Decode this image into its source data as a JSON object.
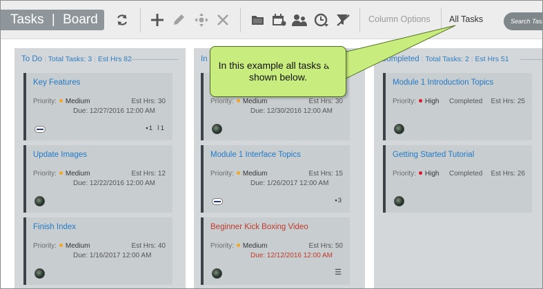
{
  "app": {
    "title": "Tasks",
    "view": "Board",
    "divider": "|"
  },
  "toolbar": {
    "icons": [
      "refresh-icon",
      "add-icon",
      "edit-icon",
      "move-icon",
      "delete-icon",
      "folder-icon",
      "calendar-icon",
      "users-icon",
      "clock-icon",
      "filter-off-icon"
    ],
    "column_options_label": "Column Options",
    "all_tasks_label": "All Tasks",
    "search_placeholder": "Search Tasks"
  },
  "callout": {
    "text": "In this example all tasks are shown below."
  },
  "columns": [
    {
      "name": "To Do",
      "total_label": "Total Tasks:",
      "total": "3",
      "est_label": "Est Hrs",
      "est": "82",
      "cards": [
        {
          "title": "Key Features",
          "priority_label": "Priority:",
          "priority": "Medium",
          "est_label": "Est Hrs:",
          "est": "30",
          "due": "Due: 12/27/2016 12:00 AM",
          "comments": "1",
          "attachments": "1"
        },
        {
          "title": "Update Images",
          "priority_label": "Priority:",
          "priority": "Medium",
          "est_label": "Est Hrs:",
          "est": "12",
          "due": "Due: 12/22/2016 12:00 AM"
        },
        {
          "title": "Finish Index",
          "priority_label": "Priority:",
          "priority": "Medium",
          "est_label": "Est Hrs:",
          "est": "40",
          "due": "Due: 1/16/2017 12:00 AM"
        }
      ]
    },
    {
      "name": "In Progress",
      "name_visible": "In",
      "cards": [
        {
          "title": "",
          "priority_label": "Priority:",
          "priority": "Medium",
          "est_label": "Est Hrs:",
          "est": "30",
          "due": "Due: 12/30/2016 12:00 AM"
        },
        {
          "title": "Module 1 Interface Topics",
          "priority_label": "Priority:",
          "priority": "Medium",
          "est_label": "Est Hrs:",
          "est": "15",
          "due": "Due: 1/26/2017 12:00 AM",
          "comments": "3"
        },
        {
          "title": "Beginner Kick Boxing Video",
          "priority_label": "Priority:",
          "priority": "Medium",
          "est_label": "Est Hrs:",
          "est": "50",
          "due": "Due: 12/12/2016 12:00 AM"
        }
      ]
    },
    {
      "name": "Completed",
      "total_label": "Total Tasks:",
      "total": "2",
      "est_label": "Est Hrs",
      "est": "51",
      "cards": [
        {
          "title": "Module 1 Introduction Topics",
          "priority_label": "Priority:",
          "priority": "High",
          "status": "Completed",
          "est_label": "Est Hrs:",
          "est": "25"
        },
        {
          "title": "Getting Started Tutorial",
          "priority_label": "Priority:",
          "priority": "High",
          "status": "Completed",
          "est_label": "Est Hrs:",
          "est": "26"
        }
      ]
    }
  ],
  "colors": {
    "medium": "#f5a623",
    "high": "#e0142c",
    "link": "#2379c4",
    "overdue": "#c0392b",
    "callout": "#c9ec7e"
  }
}
